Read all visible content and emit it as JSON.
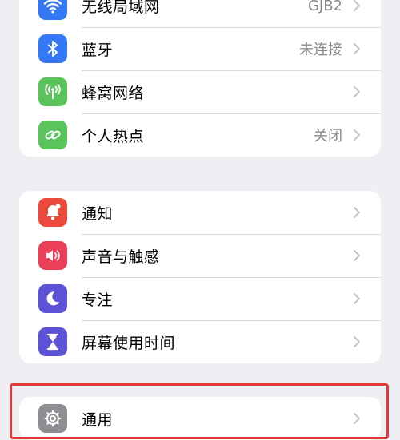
{
  "group1": {
    "items": [
      {
        "label": "无线局域网",
        "value": "GJB2",
        "icon": "wifi-icon",
        "color": "#3478f6"
      },
      {
        "label": "蓝牙",
        "value": "未连接",
        "icon": "bluetooth-icon",
        "color": "#3478f6"
      },
      {
        "label": "蜂窝网络",
        "value": "",
        "icon": "cellular-icon",
        "color": "#5ac35c"
      },
      {
        "label": "个人热点",
        "value": "关闭",
        "icon": "hotspot-icon",
        "color": "#5ac35c"
      }
    ]
  },
  "group2": {
    "items": [
      {
        "label": "通知",
        "icon": "bell-icon",
        "color": "#ec4a3c"
      },
      {
        "label": "声音与触感",
        "icon": "speaker-icon",
        "color": "#ea3f58"
      },
      {
        "label": "专注",
        "icon": "moon-icon",
        "color": "#5b52d6"
      },
      {
        "label": "屏幕使用时间",
        "icon": "hourglass-icon",
        "color": "#5b52d6"
      }
    ]
  },
  "group3": {
    "items": [
      {
        "label": "通用",
        "icon": "gear-icon",
        "color": "#8e8e93"
      }
    ]
  },
  "colors": {
    "background": "#efeef3",
    "highlight_border": "#e53935",
    "secondary_text": "#8a8a8e"
  }
}
